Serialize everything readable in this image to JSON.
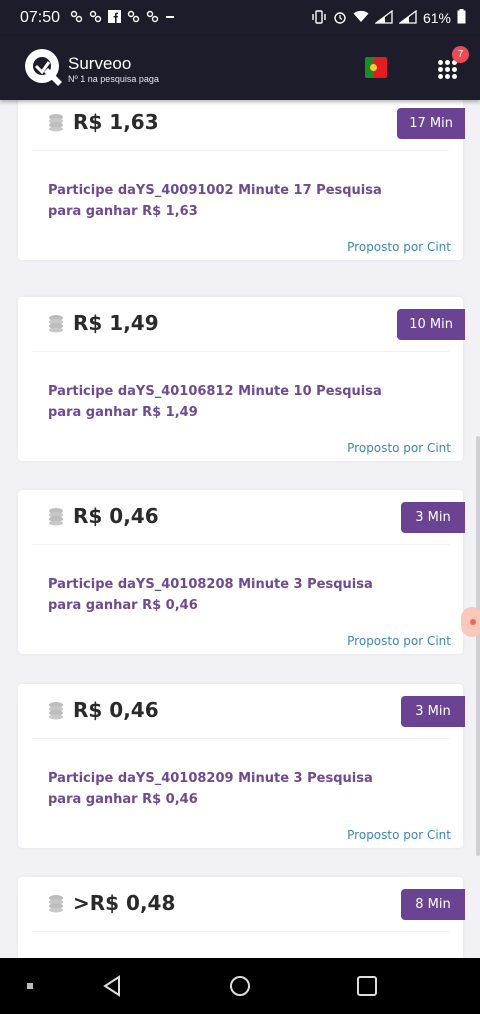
{
  "status_bar": {
    "time": "07:50",
    "battery": "61%"
  },
  "app": {
    "name": "Surveoo",
    "tagline": "Nº 1 na pesquisa paga",
    "notification_count": "7"
  },
  "colors": {
    "duration_badge": "#6a4493",
    "description_text": "#6f4a94",
    "provider_link": "#3e86b6",
    "app_bar": "#1c1c2a"
  },
  "surveys": [
    {
      "amount": "R$ 1,63",
      "duration": "17 Min",
      "description": "Participe daYS_40091002 Minute 17 Pesquisa para ganhar R$ 1,63",
      "provider": "Proposto por Cint"
    },
    {
      "amount": "R$ 1,49",
      "duration": "10 Min",
      "description": "Participe daYS_40106812 Minute 10 Pesquisa para ganhar R$ 1,49",
      "provider": "Proposto por Cint"
    },
    {
      "amount": "R$ 0,46",
      "duration": "3 Min",
      "description": "Participe daYS_40108208 Minute 3 Pesquisa para ganhar R$ 0,46",
      "provider": "Proposto por Cint"
    },
    {
      "amount": "R$ 0,46",
      "duration": "3 Min",
      "description": "Participe daYS_40108209 Minute 3 Pesquisa para ganhar R$ 0,46",
      "provider": "Proposto por Cint"
    },
    {
      "amount": ">R$ 0,48",
      "duration": "8 Min",
      "description": "",
      "provider": ""
    }
  ]
}
